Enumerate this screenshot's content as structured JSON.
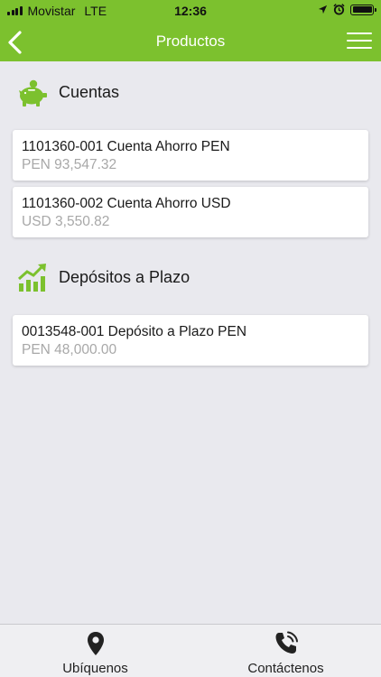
{
  "status_bar": {
    "carrier": "Movistar",
    "network": "LTE",
    "time": "12:36"
  },
  "nav": {
    "title": "Productos"
  },
  "sections": [
    {
      "title": "Cuentas",
      "icon": "piggy-bank-icon",
      "items": [
        {
          "title": "1101360-001 Cuenta Ahorro PEN",
          "amount": "PEN 93,547.32"
        },
        {
          "title": "1101360-002 Cuenta Ahorro USD",
          "amount": "USD 3,550.82"
        }
      ]
    },
    {
      "title": "Depósitos a Plazo",
      "icon": "growth-chart-icon",
      "items": [
        {
          "title": "0013548-001 Depósito a Plazo PEN",
          "amount": "PEN 48,000.00"
        }
      ]
    }
  ],
  "tabs": [
    {
      "label": "Ubíquenos",
      "icon": "location-pin-icon"
    },
    {
      "label": "Contáctenos",
      "icon": "phone-icon"
    }
  ],
  "colors": {
    "brand_green": "#7cc12e",
    "background": "#e9e9ee",
    "amount_gray": "#a8a8a8"
  }
}
